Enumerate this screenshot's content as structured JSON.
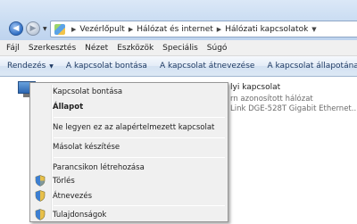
{
  "address_bar": {
    "breadcrumbs": [
      "Vezérlőpult",
      "Hálózat és internet",
      "Hálózati kapcsolatok"
    ]
  },
  "menu_bar": {
    "items": [
      "Fájl",
      "Szerkesztés",
      "Nézet",
      "Eszközök",
      "Speciális",
      "Súgó"
    ]
  },
  "command_bar": {
    "organize": "Rendezés",
    "disconnect": "A kapcsolat bontása",
    "rename": "A kapcsolat átnevezése",
    "status": "A kapcsolat állapotának m"
  },
  "connection": {
    "name": "lyi kapcsolat",
    "status": "rn azonosított hálózat",
    "device": "Link DGE-528T Gigabit Ethernet..."
  },
  "context_menu": {
    "items": [
      {
        "label": "Kapcsolat bontása",
        "bold": false,
        "shield": false
      },
      {
        "label": "Állapot",
        "bold": true,
        "shield": false
      },
      {
        "label": "Ne legyen ez az alapértelmezett kapcsolat",
        "bold": false,
        "shield": false
      },
      {
        "label": "Másolat készítése",
        "bold": false,
        "shield": false
      },
      {
        "label": "Parancsikon létrehozása",
        "bold": false,
        "shield": false
      },
      {
        "label": "Törlés",
        "bold": false,
        "shield": true
      },
      {
        "label": "Átnevezés",
        "bold": false,
        "shield": true
      },
      {
        "label": "Tulajdonságok",
        "bold": false,
        "shield": true
      }
    ]
  },
  "icons": {
    "back": "back-arrow-icon",
    "forward": "forward-arrow-icon",
    "control_panel": "control-panel-icon",
    "shield": "uac-shield-icon",
    "connection": "network-connection-icon"
  },
  "colors": {
    "command_text": "#1e3a63",
    "menu_bg": "#f0f0f0",
    "status_text": "#6d6d6d"
  }
}
